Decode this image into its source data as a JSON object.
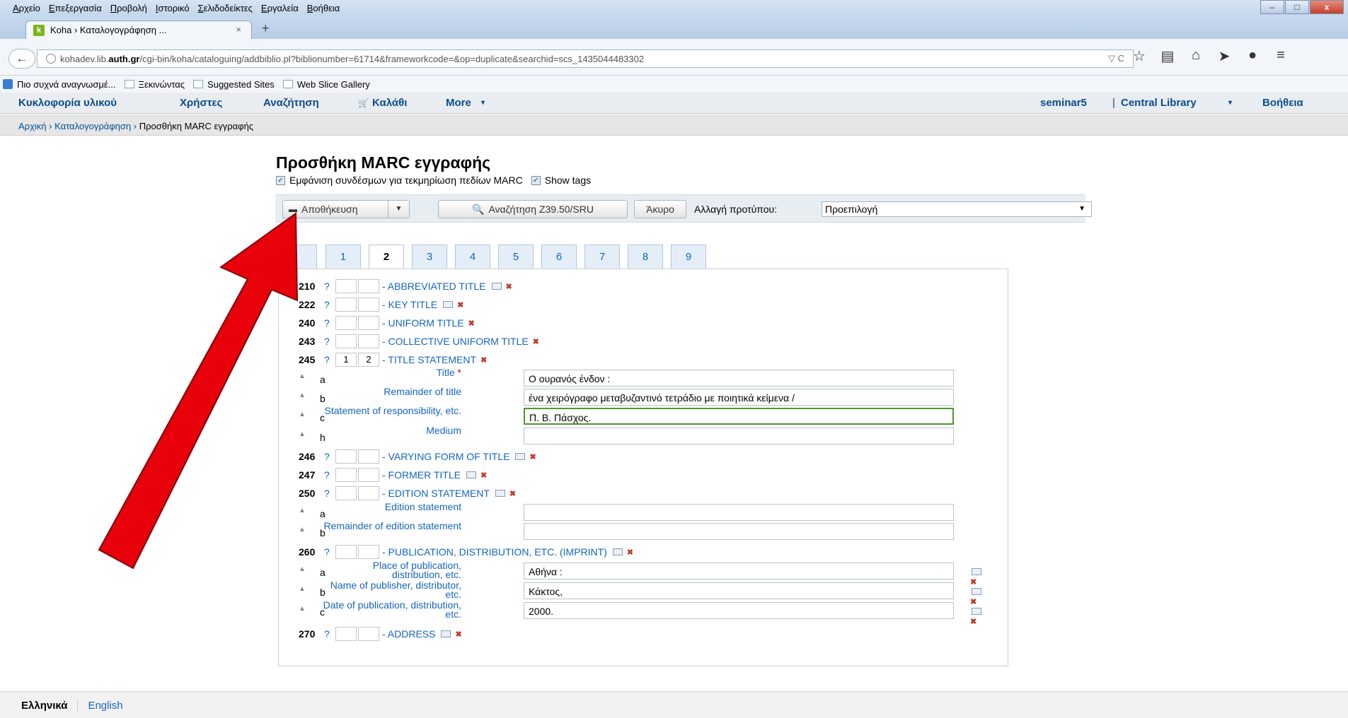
{
  "menubar": [
    "Αρχείο",
    "Επεξεργασία",
    "Προβολή",
    "Ιστορικό",
    "Σελιδοδείκτες",
    "Εργαλεία",
    "Βοήθεια"
  ],
  "browser_tab": {
    "title": "Koha › Καταλογογράφηση ...",
    "close": "×",
    "new_tab": "+"
  },
  "url": {
    "prefix": "kohadev.lib.",
    "domain": "auth.gr",
    "path": "/cgi-bin/koha/cataloguing/addbiblio.pl?biblionumber=61714&frameworkcode=&op=duplicate&searchid=scs_1435044483302",
    "controls": "▽ C"
  },
  "bookmarks": [
    "Πιο συχνά αναγνωσμέ...",
    "Ξεκινώντας",
    "Suggested Sites",
    "Web Slice Gallery"
  ],
  "koha_nav": {
    "left": [
      "Κυκλοφορία υλικού",
      "Χρήστες",
      "Αναζήτηση",
      "Καλάθι",
      "More"
    ],
    "user": "seminar5",
    "branch": "Central Library",
    "help": "Βοήθεια"
  },
  "breadcrumbs": [
    "Αρχική",
    "Καταλογογράφηση",
    "Προσθήκη MARC εγγραφής"
  ],
  "page_title": "Προσθήκη MARC εγγραφής",
  "checkboxes": [
    "Εμφάνιση συνδέσμων για τεκμηρίωση πεδίων MARC",
    "Show tags"
  ],
  "toolbar": {
    "save": "Αποθήκευση",
    "search": "Αναζήτηση Z39.50/SRU",
    "cancel": "Άκυρο",
    "framework_label": "Αλλαγή προτύπου:",
    "framework_value": "Προεπιλογή"
  },
  "tabs": [
    "1",
    "2",
    "3",
    "4",
    "5",
    "6",
    "7",
    "8",
    "9"
  ],
  "fields": [
    {
      "tag": "210",
      "i1": "",
      "i2": "",
      "name": "- ABBREVIATED TITLE"
    },
    {
      "tag": "222",
      "i1": "",
      "i2": "",
      "name": "- KEY TITLE"
    },
    {
      "tag": "240",
      "i1": "",
      "i2": "",
      "name": "- UNIFORM TITLE"
    },
    {
      "tag": "243",
      "i1": "",
      "i2": "",
      "name": "- COLLECTIVE UNIFORM TITLE"
    },
    {
      "tag": "245",
      "i1": "1",
      "i2": "2",
      "name": "- TITLE STATEMENT"
    },
    {
      "tag": "246",
      "i1": "",
      "i2": "",
      "name": "- VARYING FORM OF TITLE"
    },
    {
      "tag": "247",
      "i1": "",
      "i2": "",
      "name": "- FORMER TITLE"
    },
    {
      "tag": "250",
      "i1": "",
      "i2": "",
      "name": "- EDITION STATEMENT"
    },
    {
      "tag": "260",
      "i1": "",
      "i2": "",
      "name": "- PUBLICATION, DISTRIBUTION, ETC. (IMPRINT)"
    },
    {
      "tag": "270",
      "i1": "",
      "i2": "",
      "name": "- ADDRESS"
    }
  ],
  "subfields245": [
    {
      "code": "a",
      "label": "Title",
      "value": "Ο ουρανός ένδον :"
    },
    {
      "code": "b",
      "label": "Remainder of title",
      "value": "ένα χειρόγραφο μεταβυζαντινό τετράδιο με ποιητικά κείμενα /"
    },
    {
      "code": "c",
      "label": "Statement of responsibility, etc.",
      "value": "Π. Β. Πάσχος."
    },
    {
      "code": "h",
      "label": "Medium",
      "value": ""
    }
  ],
  "subfields250": [
    {
      "code": "a",
      "label": "Edition statement",
      "value": ""
    },
    {
      "code": "b",
      "label": "Remainder of edition statement",
      "value": ""
    }
  ],
  "subfields260": [
    {
      "code": "a",
      "label": "Place of publication, distribution, etc.",
      "value": "Αθήνα :"
    },
    {
      "code": "b",
      "label": "Name of publisher, distributor, etc.",
      "value": "Κάκτος,"
    },
    {
      "code": "c",
      "label": "Date of publication, distribution, etc.",
      "value": "2000."
    }
  ],
  "required_mark": "*",
  "q": "?",
  "languages": [
    "Ελληνικά",
    "English"
  ],
  "annotation_color": "#e8000b"
}
